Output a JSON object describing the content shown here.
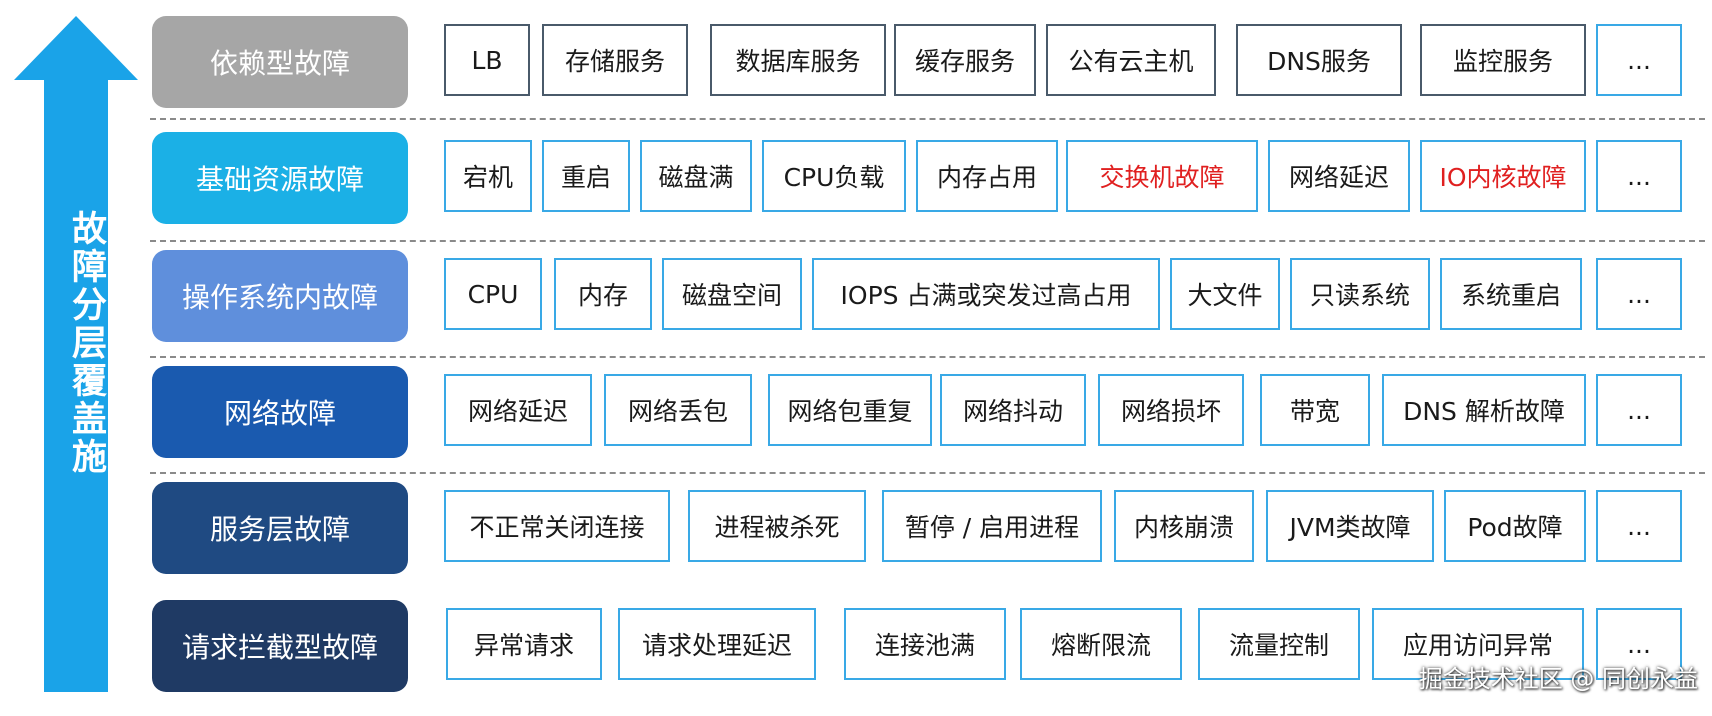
{
  "vertical_title": "故障分层覆盖施",
  "watermark": "掘金技术社区 @ 同创永益",
  "colors": {
    "arrow": "#1aa3e8",
    "row_labels": [
      "#a6a6a6",
      "#1bb0e6",
      "#5f8fdc",
      "#1a5aaf",
      "#1f4a82",
      "#1f3a64"
    ],
    "highlight_text": "#e02020"
  },
  "rows": [
    {
      "label": "依赖型故障",
      "items": [
        "LB",
        "存储服务",
        "数据库服务",
        "缓存服务",
        "公有云主机",
        "DNS服务",
        "监控服务",
        "..."
      ]
    },
    {
      "label": "基础资源故障",
      "items": [
        "宕机",
        "重启",
        "磁盘满",
        "CPU负载",
        "内存占用",
        "交换机故障",
        "网络延迟",
        "IO内核故障",
        "..."
      ],
      "highlighted": [
        "交换机故障",
        "IO内核故障"
      ]
    },
    {
      "label": "操作系统内故障",
      "items": [
        "CPU",
        "内存",
        "磁盘空间",
        "IOPS  占满或突发过高占用",
        "大文件",
        "只读系统",
        "系统重启",
        "..."
      ]
    },
    {
      "label": "网络故障",
      "items": [
        "网络延迟",
        "网络丢包",
        "网络包重复",
        "网络抖动",
        "网络损坏",
        "带宽",
        "DNS 解析故障",
        "..."
      ]
    },
    {
      "label": "服务层故障",
      "items": [
        "不正常关闭连接",
        "进程被杀死",
        "暂停 / 启用进程",
        "内核崩溃",
        "JVM类故障",
        "Pod故障",
        "..."
      ]
    },
    {
      "label": "请求拦截型故障",
      "items": [
        "异常请求",
        "请求处理延迟",
        "连接池满",
        "熔断限流",
        "流量控制",
        "应用访问异常",
        "..."
      ]
    }
  ]
}
